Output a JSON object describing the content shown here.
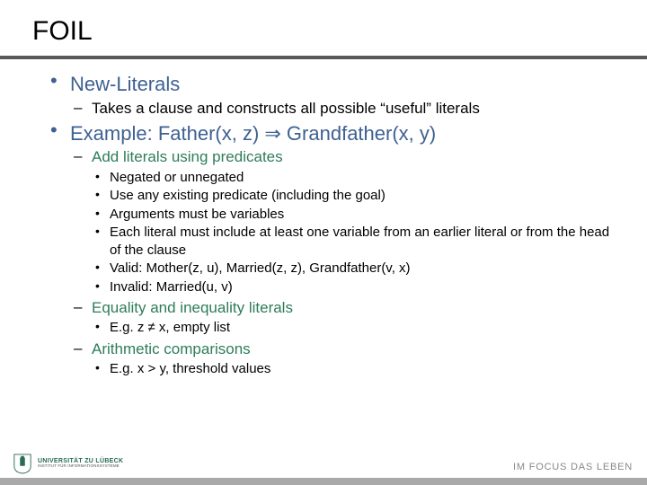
{
  "title": "FOIL",
  "bullets": [
    {
      "text": "New-Literals",
      "sub": [
        {
          "text": "Takes a clause and constructs all possible “useful” literals",
          "green": false
        }
      ]
    },
    {
      "text": "Example: Father(x, z) ⇒ Grandfather(x, y)",
      "sub": [
        {
          "text": "Add literals using predicates",
          "green": true,
          "sub": [
            {
              "text": "Negated or unnegated"
            },
            {
              "text": "Use any existing predicate (including the goal)"
            },
            {
              "text": "Arguments must be variables"
            },
            {
              "text": "Each literal must include at least one variable from an earlier literal or from the head of the clause"
            },
            {
              "text": "Valid: Mother(z, u), Married(z, z), Grandfather(v, x)"
            },
            {
              "text": "Invalid: Married(u, v)"
            }
          ]
        },
        {
          "text": "Equality and inequality literals",
          "green": true,
          "sub": [
            {
              "text": "E.g. z ≠ x, empty list"
            }
          ]
        },
        {
          "text": "Arithmetic comparisons",
          "green": true,
          "sub": [
            {
              "text": "E.g. x > y, threshold values"
            }
          ]
        }
      ]
    }
  ],
  "footer": {
    "university": "UNIVERSITÄT ZU LÜBECK",
    "institute": "INSTITUT FÜR INFORMATIONSSYSTEME",
    "tagline": "IM FOCUS DAS LEBEN"
  }
}
